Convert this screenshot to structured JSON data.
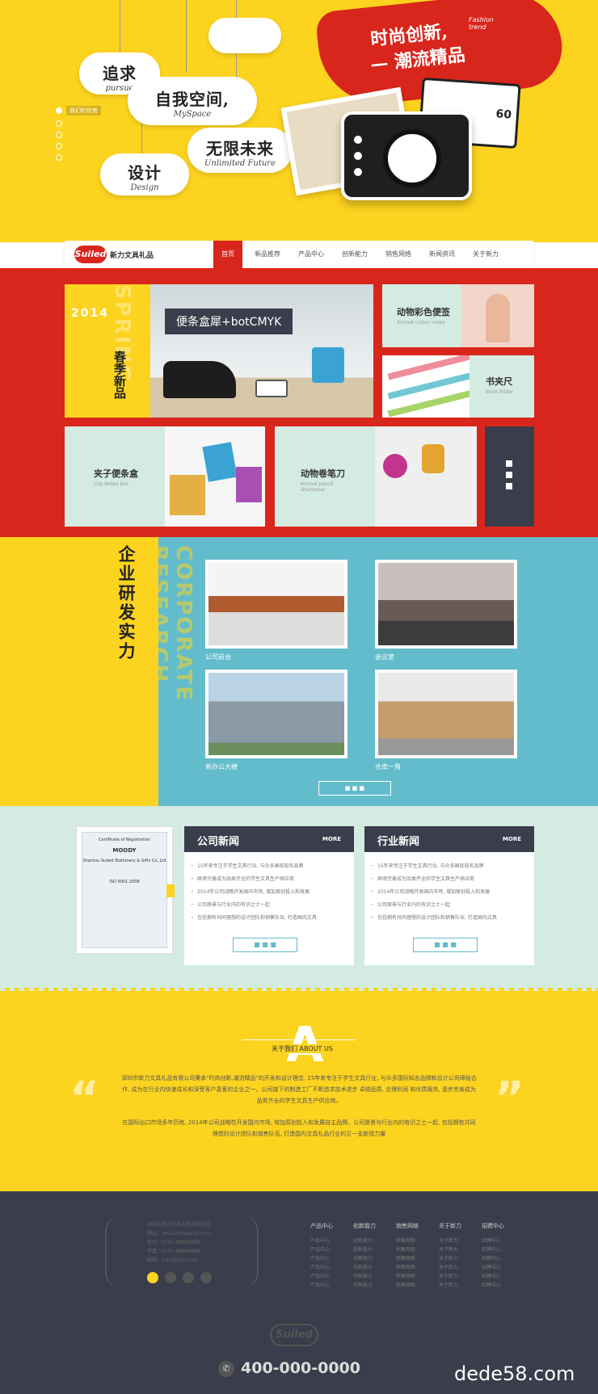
{
  "hero": {
    "clouds": [
      {
        "cn": "追求",
        "en": "pursue"
      },
      {
        "cn": "自我空间,",
        "en": "MySpace"
      },
      {
        "cn": "无限未来",
        "en": "Unlimited Future"
      },
      {
        "cn": "设计",
        "en": "Design"
      }
    ],
    "advantage_label": "我们的优势",
    "slogan_line1": "时尚创新,",
    "slogan_en": "Fashion trend",
    "slogan_line2": "— 潮流精品"
  },
  "nav": {
    "logo_badge": "Suiled",
    "logo_text": "新力文具礼品",
    "items": [
      "首页",
      "新品推荐",
      "产品中心",
      "创新能力",
      "销售网络",
      "新闻资讯",
      "关于新力"
    ]
  },
  "products": {
    "feature": {
      "year": "2014",
      "vertical": "春季新品",
      "caption": "便条盒犀+botCMYK",
      "bg_word": "SPRING"
    },
    "tiles": [
      {
        "title": "动物彩色便签",
        "sub": "Animal colour notes"
      },
      {
        "title": "书夹尺",
        "sub": "Book folder"
      },
      {
        "title": "夹子便条盒",
        "sub": "Clip Notes box"
      },
      {
        "title": "动物卷笔刀",
        "sub": "Animal pencil sharpener"
      }
    ]
  },
  "research": {
    "title": "企业研发实力",
    "bg_word": "CORPORATE RESEARCH",
    "photos": [
      {
        "caption": "公司前台"
      },
      {
        "caption": "会议室"
      },
      {
        "caption": "新办公大楼"
      },
      {
        "caption": "仓库一角"
      }
    ],
    "more": "■ ■ ■"
  },
  "news": {
    "certificate": {
      "title": "Certificate of Registration",
      "brand": "MOODY",
      "company": "Shantou Suiled Stationery & Gifts Co.,Ltd",
      "std": "ISO 9001:2008"
    },
    "company": {
      "title": "公司新闻",
      "more": "MORE",
      "items": [
        "15年来专注于学生文具行业, 与众多国际知名品牌",
        "继承完善成为品类齐全的学生文具生产供应商",
        "2014年公司战略开发国内市场, 增加原创投入和发展",
        "公司原景与行业内的有识之士一起",
        "包括拥有共同理想的设计团队和销售队伍, 打造国内文具"
      ],
      "button": "■ ■ ■"
    },
    "industry": {
      "title": "行业新闻",
      "more": "MORE",
      "items": [
        "15年来专注于学生文具行业, 与众多国际知名品牌",
        "继承完善成为品类齐全的学生文具生产供应商",
        "2014年公司战略开发国内市场, 增加原创投入和发展",
        "公司原景与行业内的有识之士一起",
        "包括拥有共同理想的设计团队和销售队伍, 打造国内文具"
      ],
      "button": "■ ■ ■"
    }
  },
  "about": {
    "letter": "A",
    "label": "关于我们 ABOUT US",
    "para1": "深圳市新力文具礼品有限公司秉承\"时尚创新,潮流精品\"的开发和设计理念, 15年来专注于学生文具行业, 与众多国际知名品牌和设计公司缔结合作, 成为在行业内快速成长和深受客户喜爱的企业之一。公司旗下的制造工厂不断追求技术进步 卓越品质, 合理利润 和优质服务, 逐步完善成为品类齐全的学生文具生产供应商。",
    "para2": "在国际出口市场多年历练, 2014年公司战略性开发国内市场, 增加原创投入和发展自主品牌。公司愿景与行业内的有识之士一起, 包括拥有共同理想的设计团队和销售队伍, 打造国内文具礼品行业的又一支新锐力量"
  },
  "footer": {
    "contact": [
      "深圳市新力文具礼品有限公司",
      "网址：www.lixinwenju.com",
      "电话：0755-88888888",
      "传真：0755-88888888",
      "邮箱：lixin@lixin.com"
    ],
    "columns": [
      {
        "head": "产品中心",
        "items": [
          "产品中心",
          "产品中心",
          "产品中心",
          "产品中心",
          "产品中心",
          "产品中心"
        ]
      },
      {
        "head": "创新能力",
        "items": [
          "创新能力",
          "创新能力",
          "创新能力",
          "创新能力",
          "创新能力",
          "创新能力"
        ]
      },
      {
        "head": "销售网络",
        "items": [
          "销售网络",
          "销售网络",
          "销售网络",
          "销售网络",
          "销售网络",
          "销售网络"
        ]
      },
      {
        "head": "关于新力",
        "items": [
          "关于新力",
          "关于新力",
          "关于新力",
          "关于新力",
          "关于新力",
          "关于新力"
        ]
      },
      {
        "head": "招聘中心",
        "items": [
          "招聘中心",
          "招聘中心",
          "招聘中心",
          "招聘中心",
          "招聘中心",
          "招聘中心"
        ]
      }
    ],
    "logo": "Suiled",
    "phone": "400-000-0000",
    "watermark": "dede58.com"
  },
  "colors": {
    "yellow": "#fcd31f",
    "red": "#d9261c",
    "blue": "#63bccc",
    "mint": "#d4ebe1",
    "dark": "#3a3d4b"
  }
}
